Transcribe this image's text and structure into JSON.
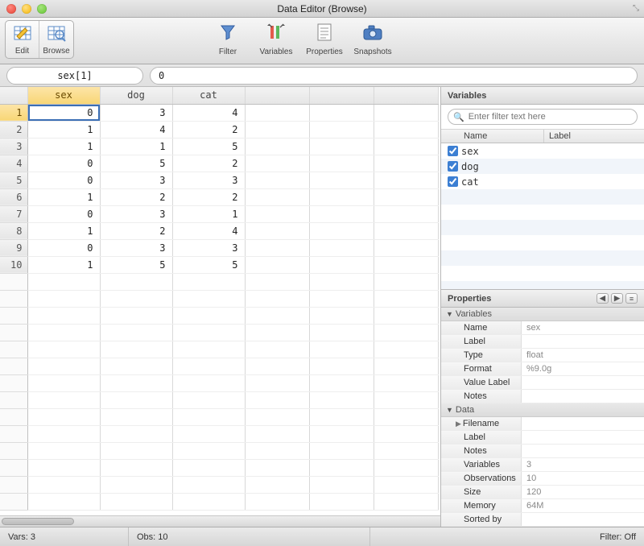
{
  "window": {
    "title": "Data Editor (Browse)"
  },
  "toolbar": {
    "edit": "Edit",
    "browse": "Browse",
    "filter": "Filter",
    "variables": "Variables",
    "properties": "Properties",
    "snapshots": "Snapshots"
  },
  "cell": {
    "addr": "sex[1]",
    "value": "0"
  },
  "columns": [
    "sex",
    "dog",
    "cat"
  ],
  "rows": [
    {
      "n": 1,
      "sex": 0,
      "dog": 3,
      "cat": 4
    },
    {
      "n": 2,
      "sex": 1,
      "dog": 4,
      "cat": 2
    },
    {
      "n": 3,
      "sex": 1,
      "dog": 1,
      "cat": 5
    },
    {
      "n": 4,
      "sex": 0,
      "dog": 5,
      "cat": 2
    },
    {
      "n": 5,
      "sex": 0,
      "dog": 3,
      "cat": 3
    },
    {
      "n": 6,
      "sex": 1,
      "dog": 2,
      "cat": 2
    },
    {
      "n": 7,
      "sex": 0,
      "dog": 3,
      "cat": 1
    },
    {
      "n": 8,
      "sex": 1,
      "dog": 2,
      "cat": 4
    },
    {
      "n": 9,
      "sex": 0,
      "dog": 3,
      "cat": 3
    },
    {
      "n": 10,
      "sex": 1,
      "dog": 5,
      "cat": 5
    }
  ],
  "empty_rows": 14,
  "empty_cols": 3,
  "variables_panel": {
    "title": "Variables",
    "filter_placeholder": "Enter filter text here",
    "col_name": "Name",
    "col_label": "Label",
    "items": [
      {
        "name": "sex",
        "checked": true
      },
      {
        "name": "dog",
        "checked": true
      },
      {
        "name": "cat",
        "checked": true
      }
    ],
    "blank_rows": 9
  },
  "properties_panel": {
    "title": "Properties",
    "sections": [
      {
        "heading": "Variables",
        "rows": [
          {
            "k": "Name",
            "v": "sex"
          },
          {
            "k": "Label",
            "v": ""
          },
          {
            "k": "Type",
            "v": "float"
          },
          {
            "k": "Format",
            "v": "%9.0g"
          },
          {
            "k": "Value Label",
            "v": ""
          },
          {
            "k": "Notes",
            "v": ""
          }
        ]
      },
      {
        "heading": "Data",
        "rows": [
          {
            "k": "Filename",
            "v": "",
            "arrow": true
          },
          {
            "k": "Label",
            "v": ""
          },
          {
            "k": "Notes",
            "v": ""
          },
          {
            "k": "Variables",
            "v": "3"
          },
          {
            "k": "Observations",
            "v": "10"
          },
          {
            "k": "Size",
            "v": "120"
          },
          {
            "k": "Memory",
            "v": "64M"
          },
          {
            "k": "Sorted by",
            "v": ""
          }
        ]
      }
    ]
  },
  "status": {
    "vars": "Vars: 3",
    "obs": "Obs: 10",
    "filter": "Filter: Off"
  }
}
